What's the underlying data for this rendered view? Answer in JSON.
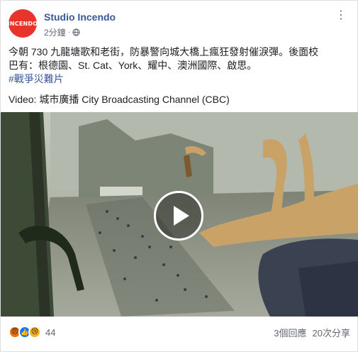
{
  "post": {
    "page_name": "Studio Incendo",
    "avatar_text": "INCENDO",
    "timestamp": "2分鐘",
    "line1": "今朝 730 九龍塘歌和老街，防暴警向城大橋上瘋狂發射催淚彈。後面校",
    "line2": "巴有：根德園、St. Cat、York、耀中、澳洲國際、啟思。",
    "hashtag": "#戰爭災難片",
    "video_caption": "Video: 城市廣播 City Broadcasting Channel (CBC)"
  },
  "footer": {
    "reaction_count": "44",
    "comments": "3個回應",
    "shares": "20次分享"
  },
  "icons": {
    "avatar": "incendo-logo",
    "privacy": "globe-icon",
    "menu": "more-options-icon",
    "play": "play-icon",
    "reactions": [
      "angry-icon",
      "like-icon",
      "sad-icon"
    ]
  },
  "colors": {
    "brand_link": "#385898",
    "avatar_bg": "#e8352b",
    "text": "#1c1e21",
    "muted": "#606770"
  }
}
